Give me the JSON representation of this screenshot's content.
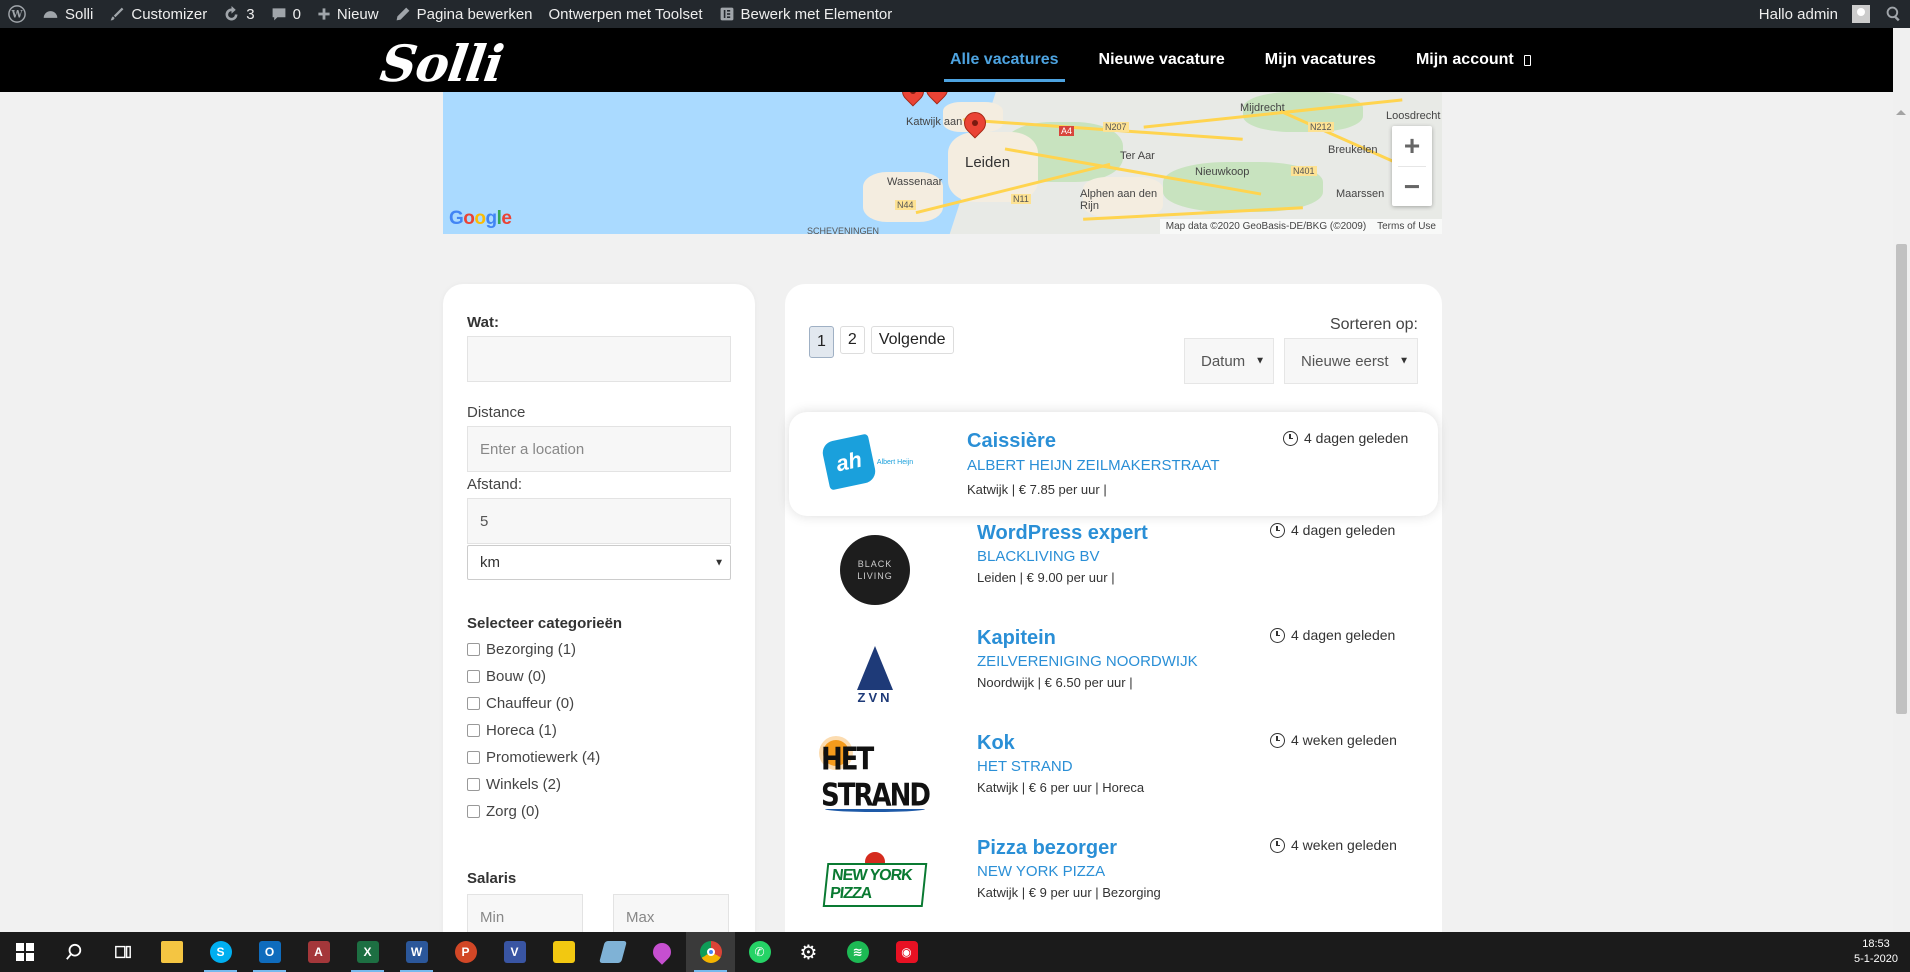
{
  "adminbar": {
    "site": "Solli",
    "customizer": "Customizer",
    "updates": "3",
    "comments": "0",
    "new": "Nieuw",
    "edit_page": "Pagina bewerken",
    "toolset": "Ontwerpen met Toolset",
    "elementor": "Bewerk met Elementor",
    "greeting": "Hallo admin"
  },
  "header": {
    "logo": "Solli",
    "nav": [
      "Alle vacatures",
      "Nieuwe vacature",
      "Mijn vacatures",
      "Mijn account"
    ]
  },
  "map": {
    "labels": {
      "katwijk": "Katwijk aan Zee",
      "leiden": "Leiden",
      "wassenaar": "Wassenaar",
      "ter_aar": "Ter Aar",
      "nieuwkoop": "Nieuwkoop",
      "alphen": "Alphen aan den Rijn",
      "mijdrecht": "Mijdrecht",
      "loosdrecht": "Loosdrecht",
      "breukelen": "Breukelen",
      "maarssen": "Maarssen",
      "scheveningen": "SCHEVENINGEN",
      "a4": "A4",
      "n207": "N207",
      "n212": "N212",
      "n11": "N11",
      "n44": "N44",
      "n401": "N401"
    },
    "zoom_in": "+",
    "zoom_out": "−",
    "google": "Google",
    "attribution": "Map data ©2020 GeoBasis-DE/BKG (©2009)",
    "terms": "Terms of Use"
  },
  "filters": {
    "wat_label": "Wat:",
    "wat_value": "",
    "distance_label": "Distance",
    "location_placeholder": "Enter a location",
    "afstand_label": "Afstand:",
    "afstand_value": "5",
    "unit": "km",
    "categories_label": "Selecteer categorieën",
    "categories": [
      "Bezorging (1)",
      "Bouw (0)",
      "Chauffeur (0)",
      "Horeca (1)",
      "Promotiewerk (4)",
      "Winkels (2)",
      "Zorg (0)"
    ],
    "salaris_label": "Salaris",
    "min_placeholder": "Min",
    "max_placeholder": "Max"
  },
  "results": {
    "pages": [
      "1",
      "2"
    ],
    "next": "Volgende",
    "sort_label": "Sorteren op:",
    "sort_field": "Datum",
    "sort_order": "Nieuwe eerst",
    "jobs": [
      {
        "title": "Caissière",
        "company": "Albert Heijn Zeilmakerstraat",
        "meta": "Katwijk | € 7.85 per uur |",
        "date": "4 dagen geleden",
        "logo": "ah"
      },
      {
        "title": "WordPress expert",
        "company": "BlackLiving BV",
        "meta": "Leiden | € 9.00 per uur |",
        "date": "4 dagen geleden",
        "logo": "blackliving"
      },
      {
        "title": "Kapitein",
        "company": "Zeilvereniging Noordwijk",
        "meta": "Noordwijk | € 6.50 per uur |",
        "date": "4 dagen geleden",
        "logo": "zvn"
      },
      {
        "title": "Kok",
        "company": "Het Strand",
        "meta": "Katwijk | € 6 per uur | Horeca",
        "date": "4 weken geleden",
        "logo": "hetstrand"
      },
      {
        "title": "Pizza bezorger",
        "company": "New York Pizza",
        "meta": "Katwijk | € 9 per uur | Bezorging",
        "date": "4 weken geleden",
        "logo": "nyp"
      }
    ],
    "logo_text": {
      "ah": "Albert Heijn",
      "blackliving_1": "BLACK",
      "blackliving_2": "LIVING",
      "zvn": "ZVN",
      "hetstrand": "HET STRAND",
      "nyp": "NEW YORK PIZZA"
    }
  },
  "taskbar": {
    "time": "18:53",
    "date": "5-1-2020"
  }
}
